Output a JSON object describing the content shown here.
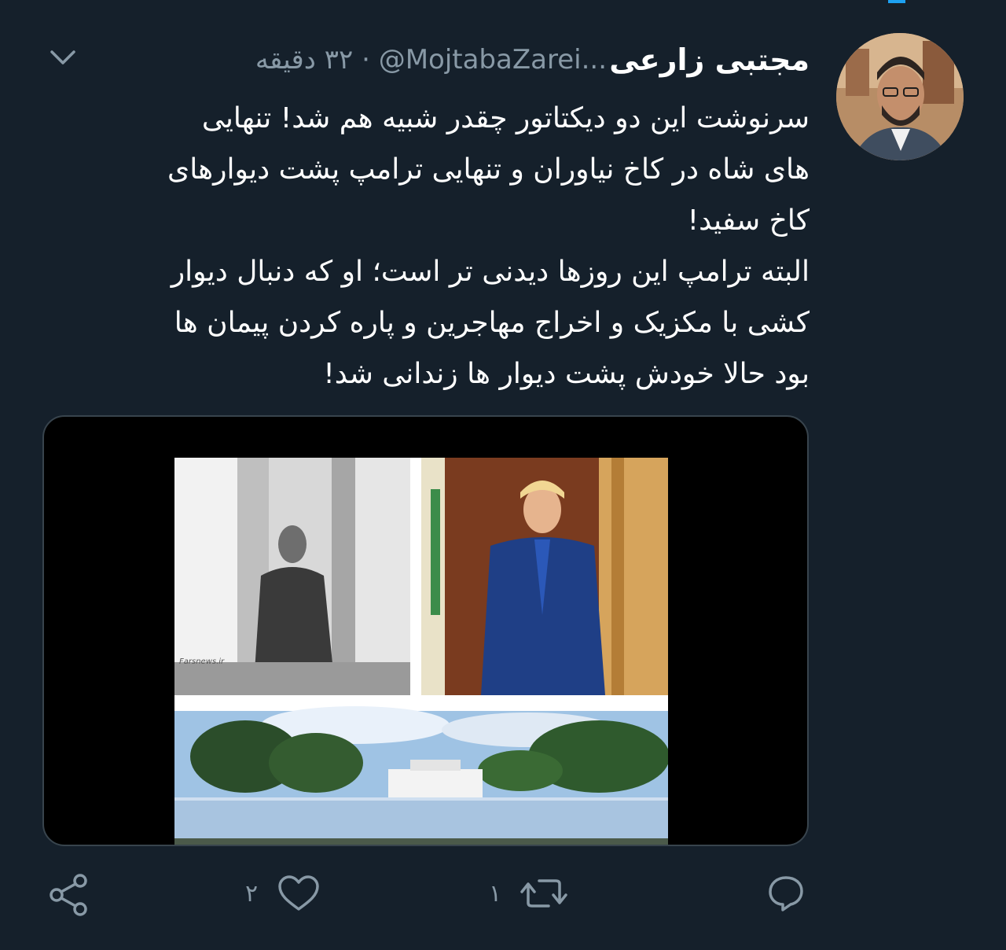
{
  "tweet": {
    "author_name": "مجتبی زارعی",
    "handle": "@MojtabaZarei...",
    "separator": "·",
    "time": "۳۲ دقیقه",
    "lines": [
      "سرنوشت این دو دیکتاتور چقدر شبیه هم شد! تنهایی",
      "های شاه در کاخ نیاوران و تنهایی ترامپ پشت دیوارهای",
      "کاخ سفید!",
      "البته ترامپ این روزها دیدنی تر است؛ او که دنبال دیوار",
      "کشی با مکزیک و اخراج مهاجرین و پاره کردن پیمان ها",
      "بود حالا خودش پشت دیوار ها زندانی شد!"
    ],
    "media_watermark": "Farsnews.ir"
  },
  "actions": {
    "reply_count": "",
    "retweet_count": "۱",
    "like_count": "۲"
  },
  "colors": {
    "background": "#15202b",
    "text": "#ffffff",
    "muted": "#8899a6",
    "accent": "#1da1f2"
  },
  "icons": [
    "chevron-down-icon",
    "reply-icon",
    "retweet-icon",
    "like-icon",
    "share-icon"
  ]
}
